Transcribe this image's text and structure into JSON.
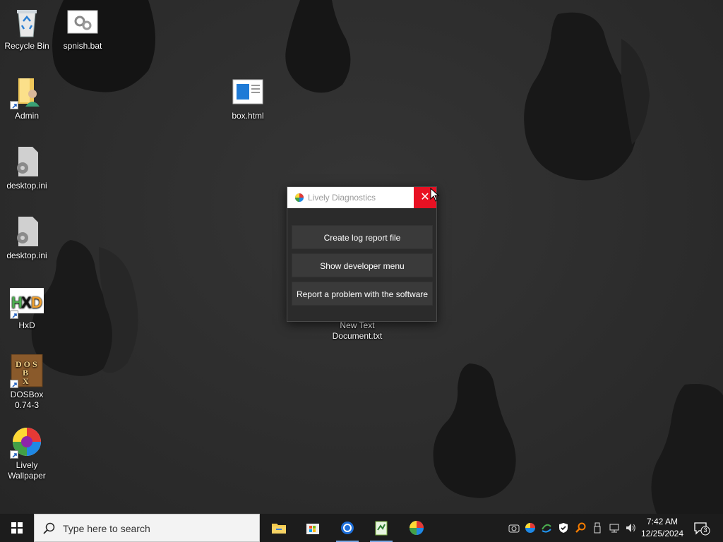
{
  "desktop_icons": [
    {
      "name": "recycle-bin",
      "label": "Recycle Bin"
    },
    {
      "name": "spnish-bat",
      "label": "spnish.bat"
    },
    {
      "name": "admin",
      "label": "Admin"
    },
    {
      "name": "box-html",
      "label": "box.html"
    },
    {
      "name": "desktop-ini-1",
      "label": "desktop.ini"
    },
    {
      "name": "desktop-ini-2",
      "label": "desktop.ini"
    },
    {
      "name": "hxd",
      "label": "HxD"
    },
    {
      "name": "dosbox",
      "label": "DOSBox 0.74-3"
    },
    {
      "name": "lively-wallpaper",
      "label": "Lively Wallpaper"
    },
    {
      "name": "new-text-document",
      "label": "New Text Document.txt"
    }
  ],
  "dialog": {
    "title": "Lively Diagnostics",
    "close_glyph": "✕",
    "buttons": [
      "Create log report file",
      "Show developer menu",
      "Report a problem with the software"
    ]
  },
  "taskbar": {
    "search_placeholder": "Type here to search",
    "apps": [
      "file-explorer",
      "microsoft-store",
      "remote-app",
      "notepad-plus",
      "lively-wallpaper"
    ],
    "clock": {
      "time": "7:42 AM",
      "date": "12/25/2024"
    },
    "notification_count": "3"
  },
  "colors": {
    "close": "#e81123",
    "taskbar": "#1c1c1c",
    "dialog_bg": "#2b2b2b",
    "button_bg": "#3a3a3a"
  }
}
